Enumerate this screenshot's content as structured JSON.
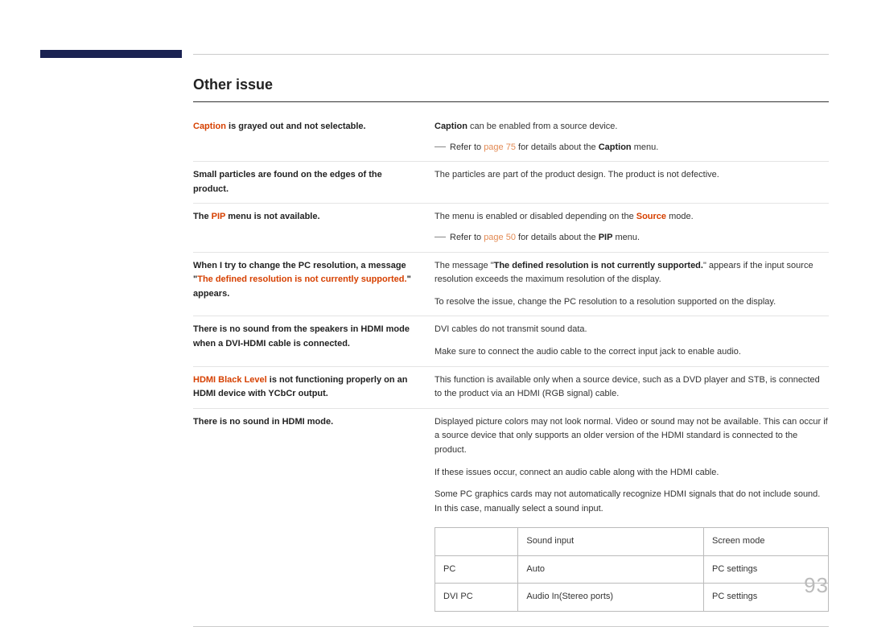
{
  "title": "Other issue",
  "rows": [
    {
      "left_prefix": "Caption",
      "left_prefix_orange": true,
      "left_rest": " is grayed out and not selectable.",
      "right": [
        {
          "segments": [
            {
              "text": "Caption",
              "bold": true
            },
            {
              "text": " can be enabled from a source device."
            }
          ]
        }
      ],
      "note": {
        "before_link": "Refer to ",
        "link": "page 75",
        "after_link": " for details about the ",
        "bold_term": "Caption",
        "after_bold": " menu."
      }
    },
    {
      "left_plain": "Small particles are found on the edges of the product.",
      "right": [
        {
          "segments": [
            {
              "text": "The particles are part of the product design. The product is not defective."
            }
          ]
        }
      ]
    },
    {
      "left_prefix": "The ",
      "left_orange_mid": "PIP",
      "left_rest": " menu is not available.",
      "right": [
        {
          "segments": [
            {
              "text": "The menu is enabled or disabled depending on the "
            },
            {
              "text": "Source",
              "orange": true
            },
            {
              "text": " mode."
            }
          ]
        }
      ],
      "note": {
        "before_link": "Refer to ",
        "link": "page 50",
        "after_link": " for details about the ",
        "bold_term": "PIP",
        "after_bold": " menu."
      }
    },
    {
      "left_html": "When I try to change the PC resolution, a message \"",
      "left_orange_tail": "The defined resolution is not currently supported.",
      "left_after_tail": "\" appears.",
      "right": [
        {
          "segments": [
            {
              "text": "The message \""
            },
            {
              "text": "The defined resolution is not currently supported.",
              "bold": true
            },
            {
              "text": "\" appears if the input source resolution exceeds the maximum resolution of the display."
            }
          ]
        },
        {
          "segments": [
            {
              "text": "To resolve the issue, change the PC resolution to a resolution supported on the display."
            }
          ],
          "para": true
        }
      ]
    },
    {
      "left_plain": "There is no sound from the speakers in HDMI mode when a DVI-HDMI cable is connected.",
      "right": [
        {
          "segments": [
            {
              "text": "DVI cables do not transmit sound data."
            }
          ]
        },
        {
          "segments": [
            {
              "text": "Make sure to connect the audio cable to the correct input jack to enable audio."
            }
          ],
          "para": true
        }
      ]
    },
    {
      "left_prefix": "HDMI Black Level",
      "left_prefix_orange": true,
      "left_rest": " is not functioning properly on an HDMI device with YCbCr output.",
      "right": [
        {
          "segments": [
            {
              "text": "This function is available only when a source device, such as a DVD player and STB, is connected to the product via an HDMI (RGB signal) cable."
            }
          ]
        }
      ]
    },
    {
      "left_plain": "There is no sound in HDMI mode.",
      "right": [
        {
          "segments": [
            {
              "text": "Displayed picture colors may not look normal. Video or sound may not be available. This can occur if a source device that only supports an older version of the HDMI standard is connected to the product."
            }
          ]
        },
        {
          "segments": [
            {
              "text": "If these issues occur, connect an audio cable along with the HDMI cable."
            }
          ],
          "para": true
        },
        {
          "segments": [
            {
              "text": "Some PC graphics cards may not automatically recognize HDMI signals that do not include sound. In this case, manually select a sound input."
            }
          ],
          "para": true
        }
      ],
      "table": {
        "headers": [
          "",
          "Sound input",
          "Screen mode"
        ],
        "rows": [
          [
            "PC",
            "Auto",
            "PC settings"
          ],
          [
            "DVI PC",
            "Audio In(Stereo ports)",
            "PC settings"
          ]
        ]
      }
    }
  ],
  "page_number": "93"
}
